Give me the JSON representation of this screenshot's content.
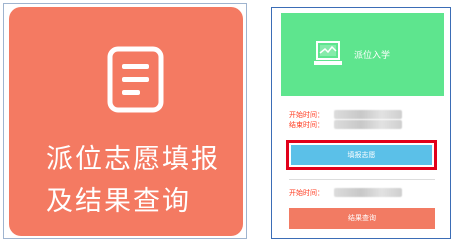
{
  "left_card": {
    "title": "派位志愿填报\n及结果查询",
    "icon": "document-icon"
  },
  "right_panel": {
    "header_title": "派位入学",
    "header_icon": "laptop-icon",
    "start_label_1": "开始时间：",
    "end_label_1": "结束时间：",
    "fill_button": "填报志愿",
    "start_label_2": "开始时间：",
    "query_button": "结果查询"
  },
  "colors": {
    "left_card_bg": "#f47a62",
    "header_bg": "#5ee58e",
    "fill_button_bg": "#5bc0e8",
    "query_button_bg": "#f27b63",
    "highlight_border": "#e1001a",
    "label_text": "#ff3b1f"
  }
}
